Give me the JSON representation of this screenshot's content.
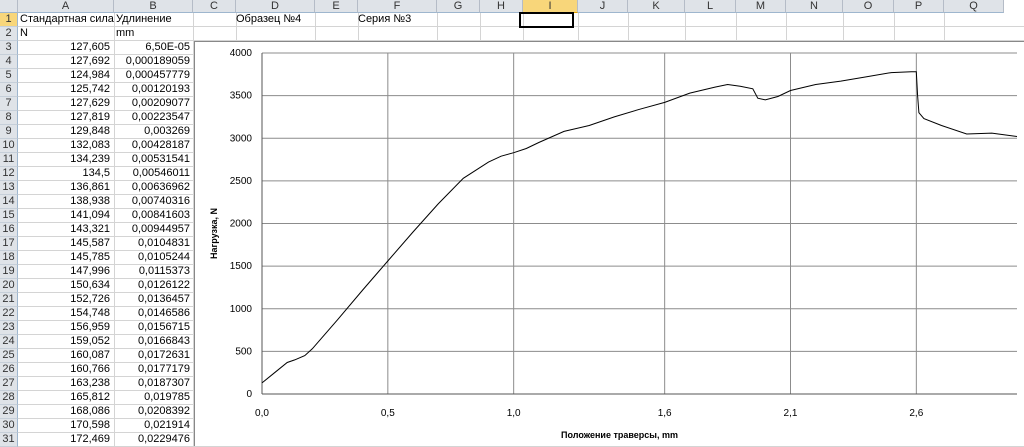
{
  "sheet": {
    "columns": [
      "A",
      "B",
      "C",
      "D",
      "E",
      "F",
      "G",
      "H",
      "I",
      "J",
      "K",
      "L",
      "M",
      "N",
      "O",
      "P",
      "Q"
    ],
    "selected_column": "I",
    "selected_row": "1",
    "header_cells": {
      "A1": "Стандартная сила",
      "B1": "Удлинение",
      "D1": "Образец №4",
      "F1": "Серия №3",
      "A2": "N",
      "B2": "mm"
    },
    "rows": [
      {
        "row": "3",
        "force": "127,605",
        "elong": "6,50E-05"
      },
      {
        "row": "4",
        "force": "127,692",
        "elong": "0,000189059"
      },
      {
        "row": "5",
        "force": "124,984",
        "elong": "0,000457779"
      },
      {
        "row": "6",
        "force": "125,742",
        "elong": "0,00120193"
      },
      {
        "row": "7",
        "force": "127,629",
        "elong": "0,00209077"
      },
      {
        "row": "8",
        "force": "127,819",
        "elong": "0,00223547"
      },
      {
        "row": "9",
        "force": "129,848",
        "elong": "0,003269"
      },
      {
        "row": "10",
        "force": "132,083",
        "elong": "0,00428187"
      },
      {
        "row": "11",
        "force": "134,239",
        "elong": "0,00531541"
      },
      {
        "row": "12",
        "force": "134,5",
        "elong": "0,00546011"
      },
      {
        "row": "13",
        "force": "136,861",
        "elong": "0,00636962"
      },
      {
        "row": "14",
        "force": "138,938",
        "elong": "0,00740316"
      },
      {
        "row": "15",
        "force": "141,094",
        "elong": "0,00841603"
      },
      {
        "row": "16",
        "force": "143,321",
        "elong": "0,00944957"
      },
      {
        "row": "17",
        "force": "145,587",
        "elong": "0,0104831"
      },
      {
        "row": "18",
        "force": "145,785",
        "elong": "0,0105244"
      },
      {
        "row": "19",
        "force": "147,996",
        "elong": "0,0115373"
      },
      {
        "row": "20",
        "force": "150,634",
        "elong": "0,0126122"
      },
      {
        "row": "21",
        "force": "152,726",
        "elong": "0,0136457"
      },
      {
        "row": "22",
        "force": "154,748",
        "elong": "0,0146586"
      },
      {
        "row": "23",
        "force": "156,959",
        "elong": "0,0156715"
      },
      {
        "row": "24",
        "force": "159,052",
        "elong": "0,0166843"
      },
      {
        "row": "25",
        "force": "160,087",
        "elong": "0,0172631"
      },
      {
        "row": "26",
        "force": "160,766",
        "elong": "0,0177179"
      },
      {
        "row": "27",
        "force": "163,238",
        "elong": "0,0187307"
      },
      {
        "row": "28",
        "force": "165,812",
        "elong": "0,019785"
      },
      {
        "row": "29",
        "force": "168,086",
        "elong": "0,0208392"
      },
      {
        "row": "30",
        "force": "170,598",
        "elong": "0,021914"
      },
      {
        "row": "31",
        "force": "172,469",
        "elong": "0,0229476"
      }
    ]
  },
  "chart_data": {
    "type": "line",
    "title": "",
    "xlabel": "Положение траверсы,  mm",
    "ylabel": "Нагрузка, N",
    "xlim": [
      0.0,
      3.0
    ],
    "ylim": [
      0,
      4000
    ],
    "x_ticks": [
      "0,0",
      "0,5",
      "1,0",
      "1,6",
      "2,1",
      "2,6"
    ],
    "x_tick_values": [
      0.0,
      0.5,
      1.0,
      1.6,
      2.1,
      2.6
    ],
    "y_ticks": [
      "0",
      "500",
      "1000",
      "1500",
      "2000",
      "2500",
      "3000",
      "3500",
      "4000"
    ],
    "y_tick_values": [
      0,
      500,
      1000,
      1500,
      2000,
      2500,
      3000,
      3500,
      4000
    ],
    "grid": true,
    "series": [
      {
        "x": [
          0.0,
          0.05,
          0.1,
          0.13,
          0.17,
          0.2,
          0.25,
          0.3,
          0.4,
          0.5,
          0.6,
          0.7,
          0.8,
          0.9,
          0.95,
          1.0,
          1.05,
          1.1,
          1.2,
          1.3,
          1.4,
          1.5,
          1.6,
          1.7,
          1.8,
          1.85,
          1.9,
          1.95,
          1.97,
          2.0,
          2.05,
          2.1,
          2.2,
          2.3,
          2.4,
          2.5,
          2.58,
          2.6,
          2.605,
          2.61,
          2.63,
          2.7,
          2.8,
          2.9,
          3.0
        ],
        "y": [
          130,
          250,
          370,
          400,
          450,
          530,
          700,
          870,
          1220,
          1560,
          1900,
          2230,
          2530,
          2720,
          2790,
          2830,
          2880,
          2950,
          3080,
          3150,
          3250,
          3340,
          3420,
          3530,
          3600,
          3630,
          3610,
          3580,
          3470,
          3450,
          3490,
          3560,
          3630,
          3670,
          3720,
          3770,
          3780,
          3780,
          3500,
          3300,
          3230,
          3150,
          3050,
          3060,
          3020
        ]
      }
    ]
  },
  "colors": {
    "header_bg": "#dfe3e8",
    "selected_header": "#f8d67a",
    "gridline": "#d4d4d4",
    "series_line": "#000000"
  }
}
